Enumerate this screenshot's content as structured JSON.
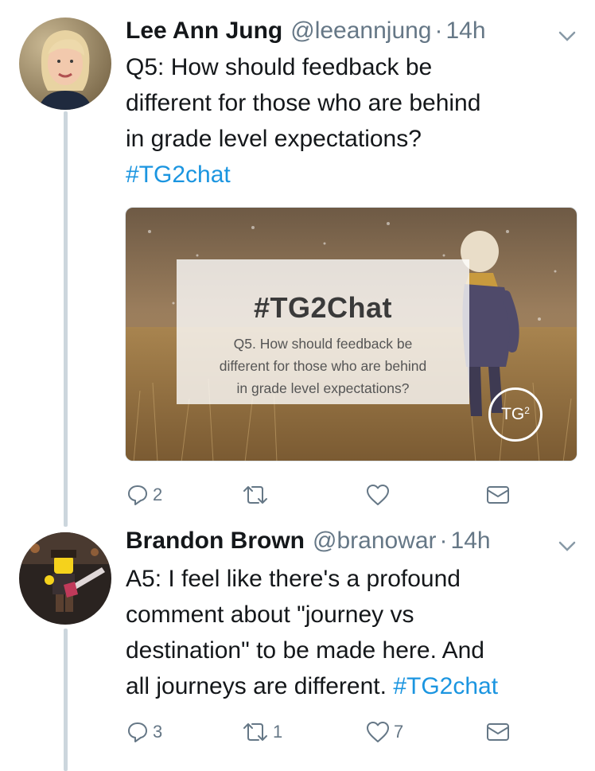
{
  "tweets": [
    {
      "name": "Lee Ann Jung",
      "handle": "@leeannjung",
      "separator": "·",
      "time": "14h",
      "text_lines": [
        "Q5: How should feedback be",
        "different for those who are behind",
        "in grade level expectations?"
      ],
      "hashtag": "#TG2chat",
      "media": {
        "title": "#TG2Chat",
        "question_lines": [
          "Q5. How should feedback be",
          "different for those who are behind",
          "in grade level expectations?"
        ],
        "logo": "TG",
        "logo_sup": "2"
      },
      "actions": {
        "reply": "2",
        "retweet": "",
        "like": "",
        "dm": ""
      }
    },
    {
      "name": "Brandon Brown",
      "handle": "@branowar",
      "separator": "·",
      "time": "14h",
      "text_lines": [
        "A5: I feel like there's a profound",
        "comment about \"journey vs",
        "destination\" to be made here. And",
        "all journeys are different. "
      ],
      "hashtag": "#TG2chat",
      "actions": {
        "reply": "3",
        "retweet": "1",
        "like": "7",
        "dm": ""
      }
    }
  ],
  "icons": [
    "reply-icon",
    "retweet-icon",
    "like-icon",
    "direct-message-icon",
    "chevron-down-icon"
  ],
  "colors": {
    "link": "#1b95e0",
    "muted": "#657786",
    "thread": "#ccd6dd",
    "text": "#14171a"
  }
}
